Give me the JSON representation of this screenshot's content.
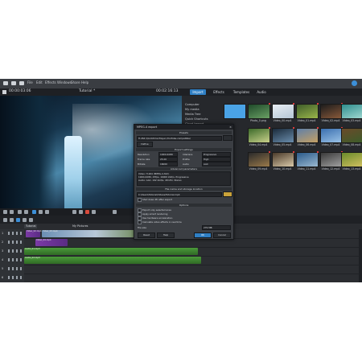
{
  "menubar": {
    "items": [
      "File",
      "Edit",
      "Effects",
      "Windows",
      "Share",
      "Help"
    ]
  },
  "titlebar": {
    "timecode_left": "00:00:03:06",
    "project_title": "Tutorial *",
    "timecode_right": "00:02:16:13"
  },
  "pool_tabs": [
    "Import",
    "Effects",
    "Templates",
    "Audio"
  ],
  "pool_tree": [
    "Computer",
    "My media",
    "Media Tree",
    "Quick Shortcuts",
    "Cloud Import"
  ],
  "pool_thumbs": [
    {
      "label": "",
      "colors": [
        "#2f6fb8",
        "#5fb0ee"
      ]
    },
    {
      "label": "Photo_0.png",
      "colors": [
        "#1f4a2a",
        "#6aa064"
      ]
    },
    {
      "label": "Video_00.mp4",
      "colors": [
        "#e8eef4",
        "#b6c7d6"
      ]
    },
    {
      "label": "Video_01.mp4",
      "colors": [
        "#3f5d2a",
        "#9ab64a"
      ]
    },
    {
      "label": "Video_02.mp4",
      "colors": [
        "#1c1c1c",
        "#8a5a3a"
      ]
    },
    {
      "label": "Video_03.mp4",
      "colors": [
        "#2f8e8e",
        "#9fd7d0"
      ]
    },
    {
      "label": "Video_04.mp4",
      "colors": [
        "#3c6a2a",
        "#c8d08a"
      ]
    },
    {
      "label": "Video_05.mp4",
      "colors": [
        "#1a2a3a",
        "#6a8cab"
      ]
    },
    {
      "label": "Video_06.mp4",
      "colors": [
        "#5f7fa8",
        "#c4a064"
      ]
    },
    {
      "label": "Video_07.mp4",
      "colors": [
        "#3a6fb0",
        "#9ac2e6"
      ]
    },
    {
      "label": "Video_08.mp4",
      "colors": [
        "#6a4a2a",
        "#3c5c2a"
      ]
    },
    {
      "label": "Video_09.mp4",
      "colors": [
        "#2a2a2a",
        "#9a7a4a"
      ]
    },
    {
      "label": "Video_10.mp4",
      "colors": [
        "#4a3a2a",
        "#d8c8a8"
      ]
    },
    {
      "label": "Video_11.mp4",
      "colors": [
        "#2a5a8a",
        "#9ab8d0"
      ]
    },
    {
      "label": "Video_12.mp4",
      "colors": [
        "#3a3a3a",
        "#a0a0a0"
      ]
    },
    {
      "label": "Video_13.mp4",
      "colors": [
        "#6a8a2a",
        "#d0c060"
      ]
    }
  ],
  "dialog": {
    "title": "MPEG-4 export",
    "close": "×",
    "section_preset": "Presets",
    "preset_value": "H.264 (Quicktime Player-/YouTube-compatible)",
    "preset_button": "Define",
    "section_output": "Export settings",
    "labels": [
      "Resolution",
      "Frame rate",
      "Bitrate"
    ],
    "values": [
      "1920x1080",
      "25.00",
      "16000"
    ],
    "right_values": [
      "Interlace",
      "Profile",
      "Audio"
    ],
    "right_fields": [
      "Progressive",
      "High",
      "AAC"
    ],
    "section_advanced": "Advanced parameters",
    "advanced_lines": [
      "Video: H.264 (MPEG-4 AVC)",
      "1920x1080, 25fps, 16000 kbit/s, Progressive",
      "Audio: AAC, 192 kbit/s, 48 kHz, Stereo"
    ],
    "section_file": "File name and storage location",
    "file_path": "C:\\Users\\Tutorial\\Videos\\Tutorial.mp4",
    "check1": "Shut down PC after export",
    "section_extra": "Options",
    "options": [
      "Export only selected area",
      "Apply smart rendering",
      "Use hardware acceleration",
      "Calculate video effects in real time"
    ],
    "output_label": "File size",
    "output_value": "279 MB",
    "buttons": [
      "Reset",
      "Help",
      "OK",
      "Cancel"
    ]
  },
  "timeline": {
    "project_tabs": [
      "Tutorial",
      "My Pictures"
    ],
    "tracks": [
      {
        "num": "1"
      },
      {
        "num": "2"
      },
      {
        "num": "3"
      },
      {
        "num": "4"
      },
      {
        "num": "5"
      },
      {
        "num": "6"
      }
    ],
    "clips": [
      {
        "track": 0,
        "label": "Video_02.mp4",
        "kind": "video"
      },
      {
        "track": 0,
        "label": "Video_03.mp4",
        "kind": "video"
      },
      {
        "track": 1,
        "label": "Video_04.mp4",
        "kind": "video"
      },
      {
        "track": 2,
        "label": "Audio_01.mp3",
        "kind": "audio"
      },
      {
        "track": 3,
        "label": "Audio_02.mp3",
        "kind": "audio"
      }
    ]
  }
}
